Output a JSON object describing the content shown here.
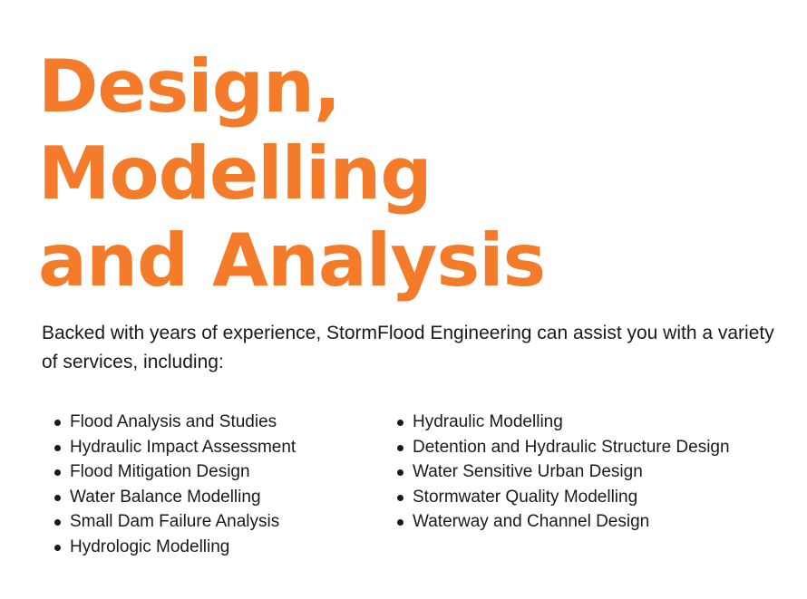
{
  "colors": {
    "accent": "#f47b2a",
    "text": "#1a1a1a",
    "background": "#ffffff"
  },
  "headline": {
    "lines": [
      "Design,",
      "Modelling",
      "and Analysis"
    ]
  },
  "intro": {
    "text": "Backed with years of experience, StormFlood Engineering can assist you with a variety of services, including:"
  },
  "services": {
    "left": [
      "Flood Analysis and Studies",
      "Hydraulic Impact Assessment",
      "Flood Mitigation Design",
      "Water Balance Modelling",
      "Small Dam Failure Analysis",
      "Hydrologic Modelling"
    ],
    "right": [
      "Hydraulic Modelling",
      "Detention and Hydraulic Structure Design",
      "Water Sensitive Urban Design",
      "Stormwater Quality Modelling",
      "Waterway and Channel Design"
    ]
  }
}
